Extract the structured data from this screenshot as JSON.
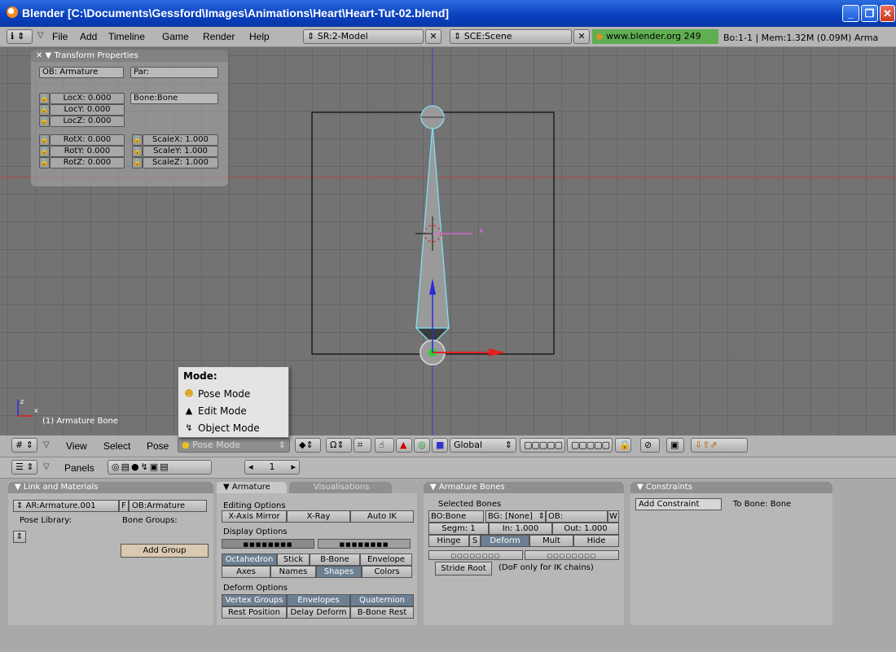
{
  "window": {
    "title": "Blender [C:\\Documents\\Gessford\\Images\\Animations\\Heart\\Heart-Tut-02.blend]"
  },
  "top_header": {
    "menus": [
      "File",
      "Add",
      "Timeline",
      "Game",
      "Render",
      "Help"
    ],
    "screen": "SR:2-Model",
    "scene": "SCE:Scene",
    "url": "www.blender.org 249",
    "stats": "Bo:1-1  | Mem:1.32M (0.09M) Arma"
  },
  "transform_props": {
    "title": "Transform Properties",
    "ob": "OB: Armature",
    "par": "Par:",
    "bone": "Bone:Bone",
    "locx": "LocX: 0.000",
    "locy": "LocY: 0.000",
    "locz": "LocZ: 0.000",
    "rotx": "RotX: 0.000",
    "roty": "RotY: 0.000",
    "rotz": "RotZ: 0.000",
    "scalex": "ScaleX: 1.000",
    "scaley": "ScaleY: 1.000",
    "scalez": "ScaleZ: 1.000"
  },
  "viewport": {
    "object_label": "(1) Armature Bone"
  },
  "mode_menu": {
    "title": "Mode:",
    "items": [
      "Pose Mode",
      "Edit Mode",
      "Object Mode"
    ]
  },
  "view_header": {
    "menus": [
      "View",
      "Select",
      "Pose"
    ],
    "mode": "Pose Mode",
    "orientation": "Global"
  },
  "buttons_header": {
    "panels_label": "Panels",
    "frame": "1"
  },
  "link_materials": {
    "title": "Link and Materials",
    "ar": "AR:Armature.001",
    "f": "F",
    "ob": "OB:Armature",
    "pose_library": "Pose Library:",
    "bone_groups": "Bone Groups:",
    "add_group": "Add Group"
  },
  "armature": {
    "tab_active": "Armature",
    "tab_inactive": "Visualisations",
    "editing_options": "Editing Options",
    "x_axis_mirror": "X-Axis Mirror",
    "x_ray": "X-Ray",
    "auto_ik": "Auto IK",
    "display_options": "Display Options",
    "octahedron": "Octahedron",
    "stick": "Stick",
    "bbone": "B-Bone",
    "envelope": "Envelope",
    "axes": "Axes",
    "names": "Names",
    "shapes": "Shapes",
    "colors": "Colors",
    "deform_options": "Deform Options",
    "vertex_groups": "Vertex Groups",
    "envelopes": "Envelopes",
    "quaternion": "Quaternion",
    "rest_position": "Rest Position",
    "delay_deform": "Delay Deform",
    "bbone_rest": "B-Bone Rest"
  },
  "armature_bones": {
    "title": "Armature Bones",
    "selected_bones": "Selected Bones",
    "bo": "BO:Bone",
    "bg": "BG: [None]",
    "ob": "OB:",
    "w": "W",
    "segm": "Segm: 1",
    "in": "In: 1.000",
    "out": "Out: 1.000",
    "hinge": "Hinge",
    "s": "S",
    "deform": "Deform",
    "mult": "Mult",
    "hide": "Hide",
    "stride_root": "Stride Root",
    "dof_note": "(DoF only for IK chains)"
  },
  "constraints": {
    "title": "Constraints",
    "add_constraint": "Add Constraint",
    "to_bone": "To Bone: Bone"
  },
  "colors": {
    "active_button": "#6d7f92",
    "bone_outline": "#7fe0f0",
    "x_axis": "#ff2020"
  }
}
